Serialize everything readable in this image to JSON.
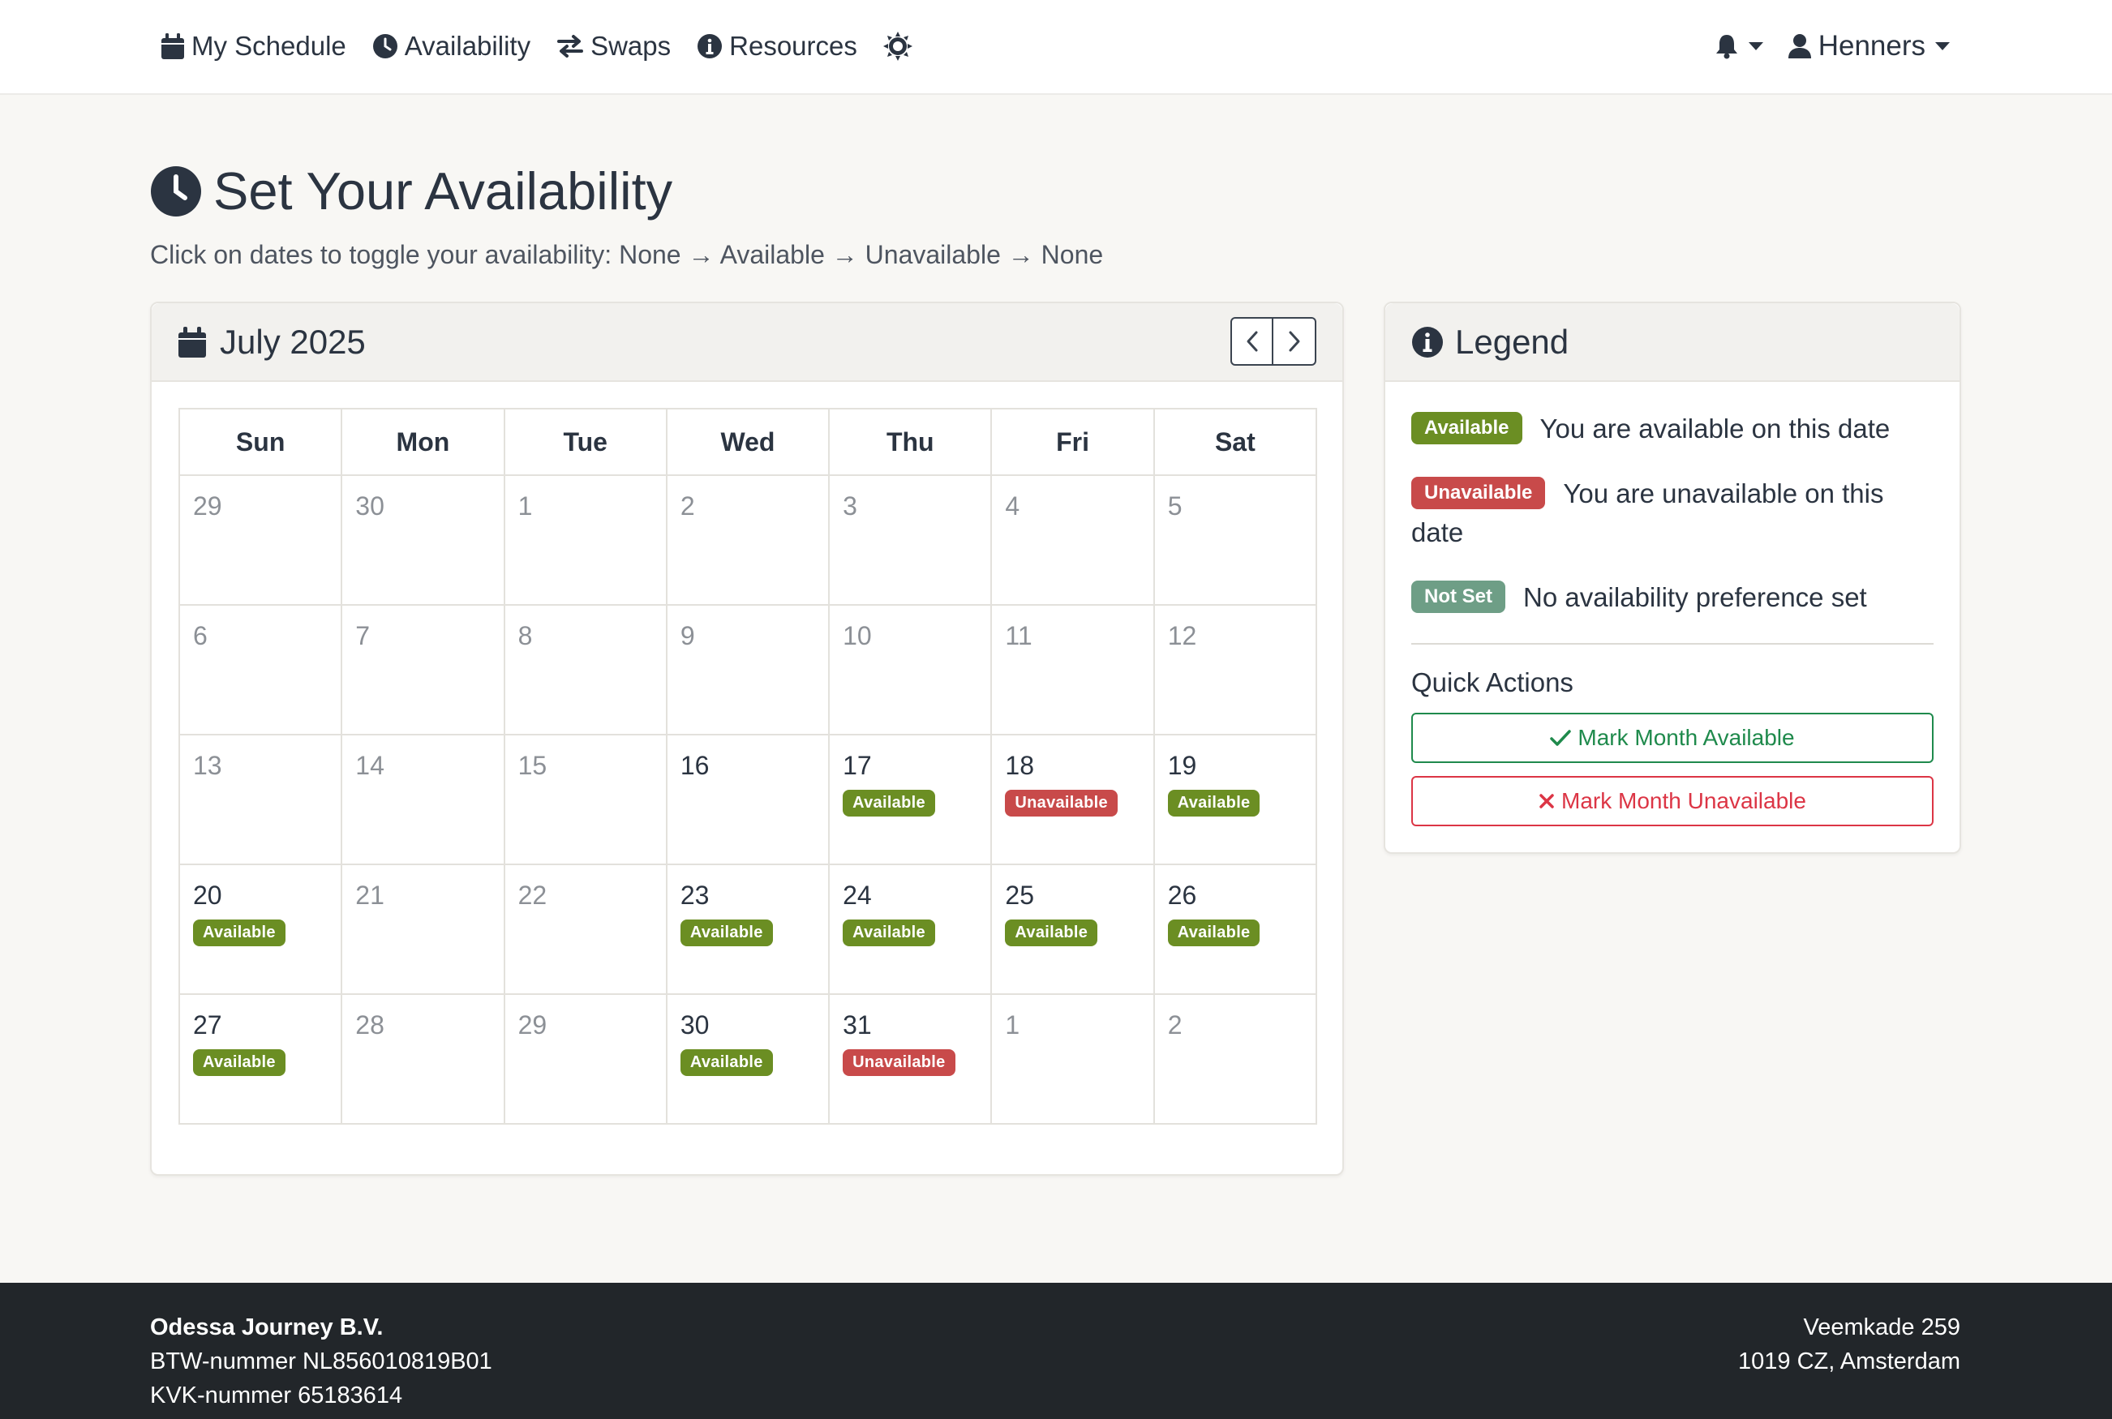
{
  "nav": {
    "items": [
      {
        "label": "My Schedule",
        "icon": "calendar-icon"
      },
      {
        "label": "Availability",
        "icon": "clock-icon"
      },
      {
        "label": "Swaps",
        "icon": "swap-arrows-icon"
      },
      {
        "label": "Resources",
        "icon": "info-circle-icon"
      }
    ],
    "theme_icon": "sun-icon",
    "notifications_icon": "bell-icon",
    "user": {
      "name": "Henners",
      "icon": "user-icon"
    }
  },
  "header": {
    "title": "Set Your Availability",
    "subtitle": "Click on dates to toggle your availability: None → Available → Unavailable → None"
  },
  "calendar": {
    "month_label": "July 2025",
    "weekdays": [
      "Sun",
      "Mon",
      "Tue",
      "Wed",
      "Thu",
      "Fri",
      "Sat"
    ],
    "weeks": [
      [
        {
          "day": "29",
          "state": "muted",
          "badge": ""
        },
        {
          "day": "30",
          "state": "muted",
          "badge": ""
        },
        {
          "day": "1",
          "state": "muted",
          "badge": ""
        },
        {
          "day": "2",
          "state": "muted",
          "badge": ""
        },
        {
          "day": "3",
          "state": "muted",
          "badge": ""
        },
        {
          "day": "4",
          "state": "muted",
          "badge": ""
        },
        {
          "day": "5",
          "state": "muted",
          "badge": ""
        }
      ],
      [
        {
          "day": "6",
          "state": "muted",
          "badge": ""
        },
        {
          "day": "7",
          "state": "muted",
          "badge": ""
        },
        {
          "day": "8",
          "state": "muted",
          "badge": ""
        },
        {
          "day": "9",
          "state": "muted",
          "badge": ""
        },
        {
          "day": "10",
          "state": "muted",
          "badge": ""
        },
        {
          "day": "11",
          "state": "muted",
          "badge": ""
        },
        {
          "day": "12",
          "state": "muted",
          "badge": ""
        }
      ],
      [
        {
          "day": "13",
          "state": "muted",
          "badge": ""
        },
        {
          "day": "14",
          "state": "muted",
          "badge": ""
        },
        {
          "day": "15",
          "state": "muted",
          "badge": ""
        },
        {
          "day": "16",
          "state": "active",
          "badge": ""
        },
        {
          "day": "17",
          "state": "active",
          "badge": "Available"
        },
        {
          "day": "18",
          "state": "active",
          "badge": "Unavailable"
        },
        {
          "day": "19",
          "state": "active",
          "badge": "Available"
        }
      ],
      [
        {
          "day": "20",
          "state": "active",
          "badge": "Available"
        },
        {
          "day": "21",
          "state": "muted",
          "badge": ""
        },
        {
          "day": "22",
          "state": "muted",
          "badge": ""
        },
        {
          "day": "23",
          "state": "active",
          "badge": "Available"
        },
        {
          "day": "24",
          "state": "active",
          "badge": "Available"
        },
        {
          "day": "25",
          "state": "active",
          "badge": "Available"
        },
        {
          "day": "26",
          "state": "active",
          "badge": "Available"
        }
      ],
      [
        {
          "day": "27",
          "state": "active",
          "badge": "Available"
        },
        {
          "day": "28",
          "state": "muted",
          "badge": ""
        },
        {
          "day": "29",
          "state": "muted",
          "badge": ""
        },
        {
          "day": "30",
          "state": "active",
          "badge": "Available"
        },
        {
          "day": "31",
          "state": "active",
          "badge": "Unavailable"
        },
        {
          "day": "1",
          "state": "muted",
          "badge": ""
        },
        {
          "day": "2",
          "state": "muted",
          "badge": ""
        }
      ]
    ]
  },
  "legend": {
    "title": "Legend",
    "items": [
      {
        "badge": "Available",
        "text": "You are available on this date",
        "kind": "available"
      },
      {
        "badge": "Unavailable",
        "text": "You are unavailable on this date",
        "kind": "unavailable"
      },
      {
        "badge": "Not Set",
        "text": "No availability preference set",
        "kind": "notset"
      }
    ],
    "quick_actions_title": "Quick Actions",
    "mark_available_label": "Mark Month Available",
    "mark_unavailable_label": "Mark Month Unavailable"
  },
  "footer": {
    "company": "Odessa Journey B.V.",
    "btw": "BTW-nummer NL856010819B01",
    "kvk": "KVK-nummer 65183614",
    "address_line1": "Veemkade 259",
    "address_line2": "1019 CZ, Amsterdam"
  },
  "colors": {
    "available": "#6b8e23",
    "unavailable": "#c84a4a",
    "not_set": "#6e9e86",
    "footer_bg": "#22262a",
    "text": "#2b3441"
  }
}
